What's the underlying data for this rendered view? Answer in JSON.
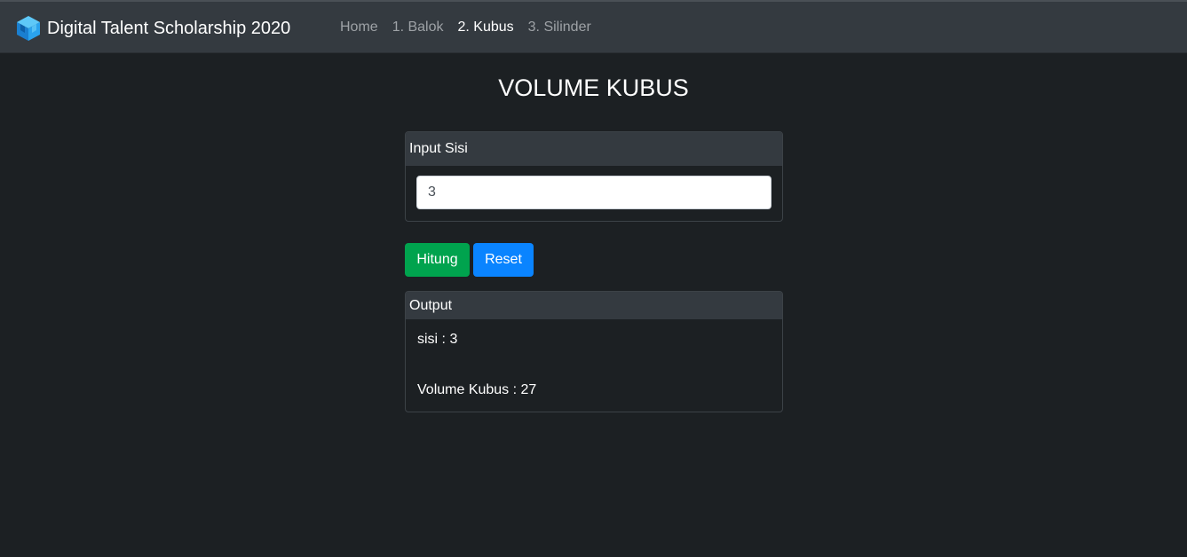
{
  "navbar": {
    "brand": "Digital Talent Scholarship 2020",
    "brand_icon": "cube-logo-icon",
    "links": [
      {
        "label": "Home",
        "active": false
      },
      {
        "label": "1. Balok",
        "active": false
      },
      {
        "label": "2. Kubus",
        "active": true
      },
      {
        "label": "3. Silinder",
        "active": false
      }
    ]
  },
  "page": {
    "title": "VOLUME KUBUS"
  },
  "input_card": {
    "header": "Input Sisi",
    "value": "3"
  },
  "buttons": {
    "hitung": "Hitung",
    "reset": "Reset"
  },
  "output_card": {
    "header": "Output",
    "sisi_line": "sisi : 3",
    "volume_line": "Volume Kubus : 27"
  },
  "colors": {
    "background": "#1c2023",
    "navbar": "#343a40",
    "hitung": "#00a34e",
    "reset": "#0a84ff"
  }
}
